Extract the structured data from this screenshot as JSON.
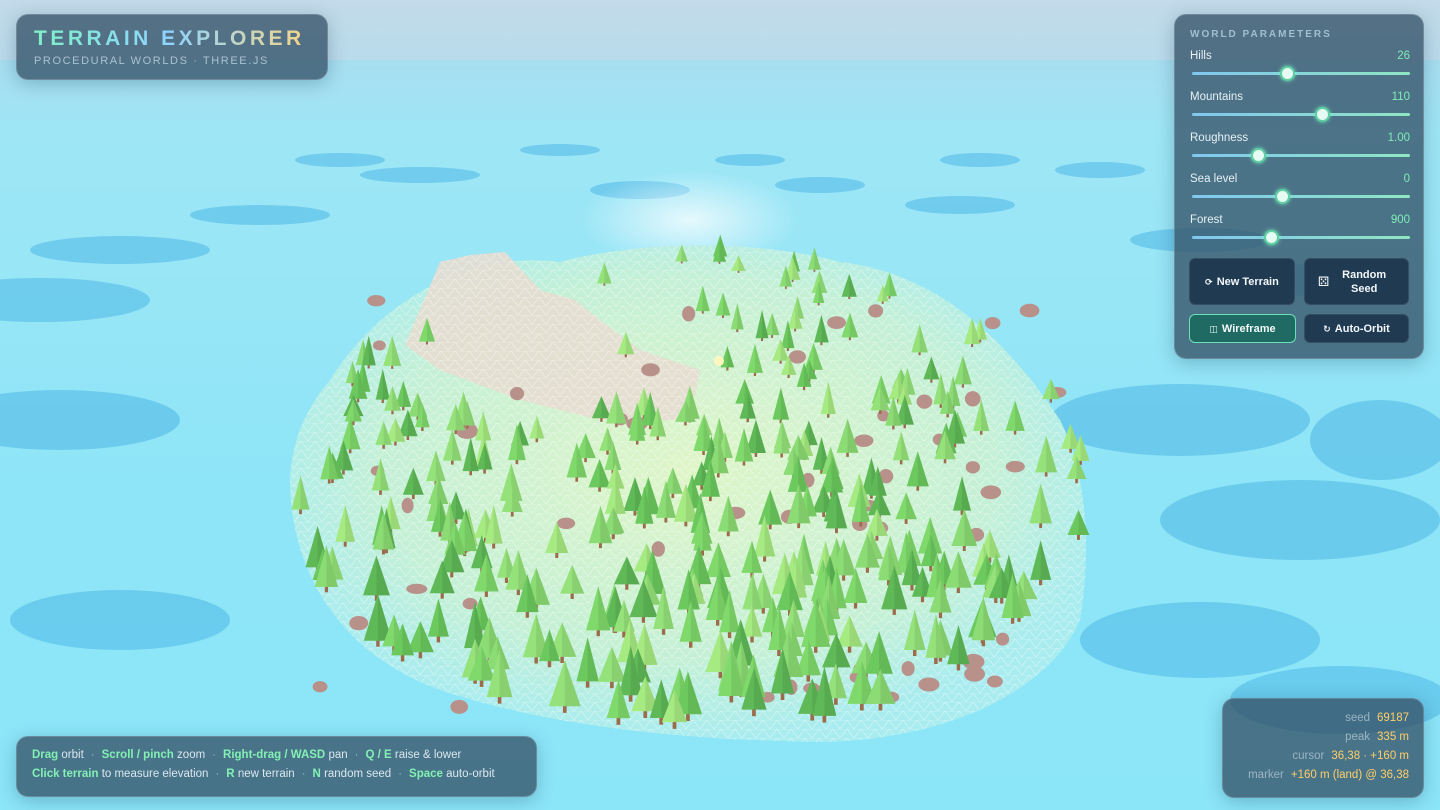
{
  "app": {
    "title": "TERRAIN EXPLORER",
    "subtitle": "PROCEDURAL WORLDS · THREE.JS"
  },
  "params": {
    "heading": "WORLD PARAMETERS",
    "sliders": [
      {
        "label": "Hills",
        "value": "26",
        "level": 0.44
      },
      {
        "label": "Mountains",
        "value": "110",
        "level": 0.6
      },
      {
        "label": "Roughness",
        "value": "1.00",
        "level": 0.31
      },
      {
        "label": "Sea level",
        "value": "0",
        "level": 0.42
      },
      {
        "label": "Forest",
        "value": "900",
        "level": 0.37
      }
    ],
    "buttons": {
      "new_terrain": "New Terrain",
      "random_seed": "Random Seed",
      "wireframe": "Wireframe",
      "auto_orbit": "Auto-Orbit"
    },
    "icons": {
      "new_terrain": "refresh-icon",
      "random_seed": "dice-icon",
      "wireframe": "grid-icon",
      "auto_orbit": "orbit-icon"
    },
    "wireframe_active": true
  },
  "stats": {
    "seed_label": "seed",
    "seed_value": "69187",
    "peak_label": "peak",
    "peak_value": "335 m",
    "cursor_label": "cursor",
    "cursor_value": "36,38 · +160 m",
    "marker_label": "marker",
    "marker_value": "+160 m (land) @ 36,38"
  },
  "help": {
    "line1": [
      {
        "key": "Drag",
        "text": "orbit"
      },
      {
        "key": "Scroll / pinch",
        "text": "zoom"
      },
      {
        "key": "Right-drag / WASD",
        "text": "pan"
      },
      {
        "key": "Q / E",
        "text": "raise & lower"
      }
    ],
    "line2": [
      {
        "key": "Click terrain",
        "text": "to measure elevation"
      },
      {
        "key": "R",
        "text": "new terrain"
      },
      {
        "key": "N",
        "text": "random seed"
      },
      {
        "key": "Space",
        "text": "auto-orbit"
      }
    ]
  },
  "colors": {
    "accent": "#7feeb8",
    "value": "#ffcf6a",
    "panel": "#345268",
    "water": "#8ee5f7",
    "deep_water": "#4fb6e6"
  }
}
